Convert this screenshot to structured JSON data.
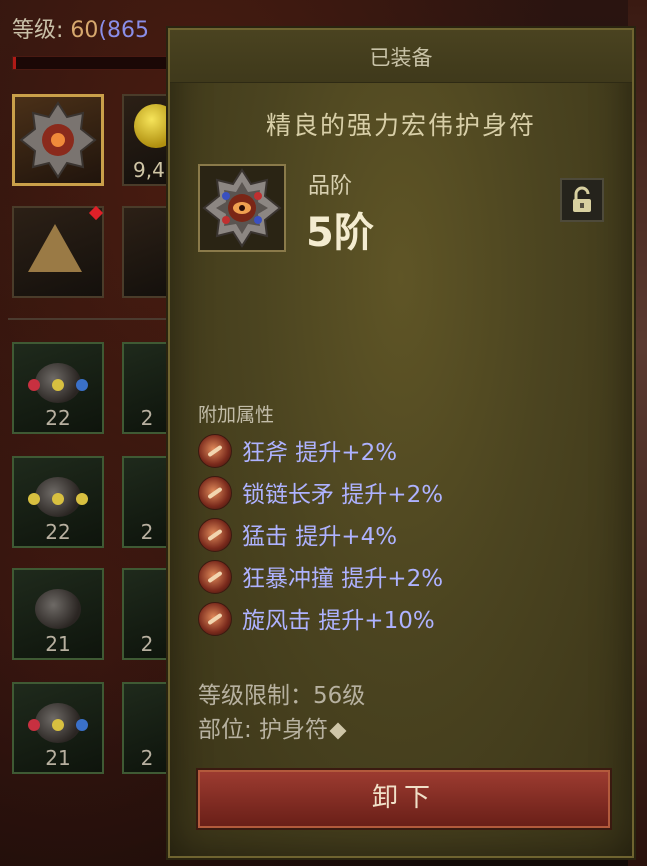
{
  "background": {
    "level_label": "等级: ",
    "level_value": "60",
    "paragon_value": "(865",
    "gold_text": "9,4",
    "xp_progress": 0.02,
    "slot_counts": [
      "22",
      "22",
      "21",
      "21"
    ],
    "side_counts": [
      "2",
      "2",
      "2",
      "2"
    ]
  },
  "tooltip": {
    "header": "已装备",
    "item_name": "精良的强力宏伟护身符",
    "tier_label": "品阶",
    "tier_value": "5阶",
    "lock_icon": "unlock-icon",
    "affix_section_title": "附加属性",
    "affixes": [
      {
        "icon": "frenzy-axe-icon",
        "text": "狂斧  提升+2%"
      },
      {
        "icon": "chain-spear-icon",
        "text": "锁链长矛  提升+2%"
      },
      {
        "icon": "bash-icon",
        "text": "猛击  提升+4%"
      },
      {
        "icon": "berserk-charge-icon",
        "text": "狂暴冲撞  提升+2%"
      },
      {
        "icon": "whirlwind-icon",
        "text": "旋风击  提升+10%"
      }
    ],
    "level_requirement": "等级限制：56级",
    "slot_label": "部位: 护身符",
    "unequip_label": "卸下"
  },
  "colors": {
    "panel_bg": "#4b4420",
    "affix_text": "#aeb2ff",
    "button": "#8a3028",
    "xp_bar": "#b01a16"
  }
}
